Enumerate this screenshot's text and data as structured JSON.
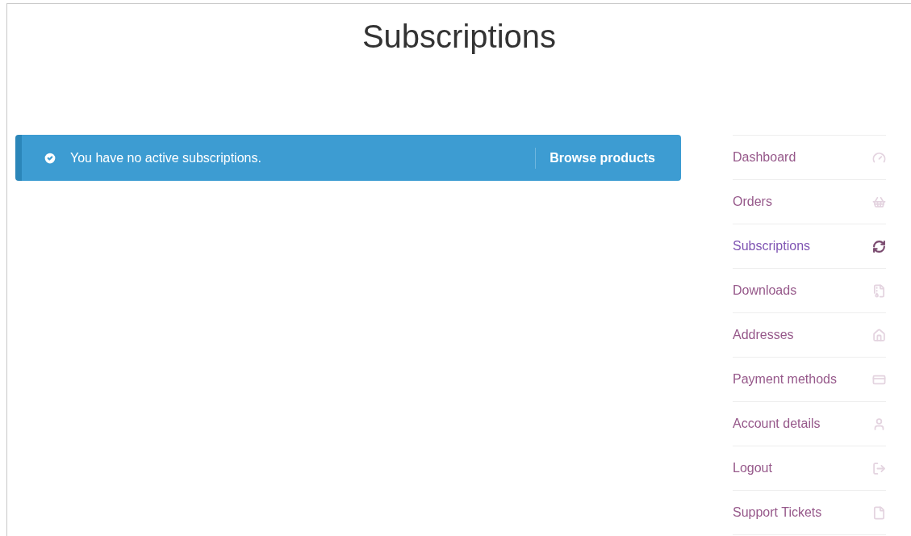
{
  "page": {
    "title": "Subscriptions"
  },
  "notice": {
    "message": "You have no active subscriptions.",
    "action": "Browse products"
  },
  "nav": [
    {
      "label": "Dashboard",
      "kind": "gauge",
      "selected": false
    },
    {
      "label": "Orders",
      "kind": "basket",
      "selected": false
    },
    {
      "label": "Subscriptions",
      "kind": "refresh",
      "selected": true
    },
    {
      "label": "Downloads",
      "kind": "archive",
      "selected": false
    },
    {
      "label": "Addresses",
      "kind": "home",
      "selected": false
    },
    {
      "label": "Payment methods",
      "kind": "card",
      "selected": false
    },
    {
      "label": "Account details",
      "kind": "user",
      "selected": false
    },
    {
      "label": "Logout",
      "kind": "logout",
      "selected": false
    },
    {
      "label": "Support Tickets",
      "kind": "file",
      "selected": false
    }
  ]
}
